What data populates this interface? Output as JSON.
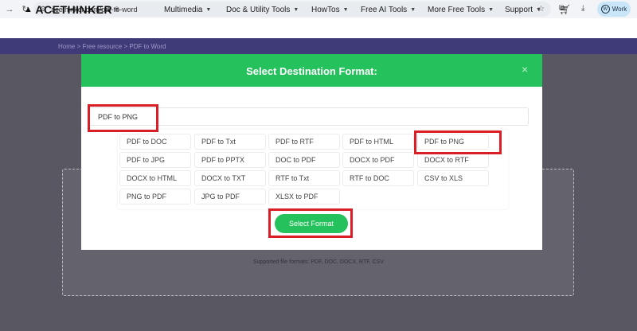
{
  "browser": {
    "url": "acethinker.com/pdf-to-word",
    "profile_label": "Work"
  },
  "header": {
    "logo_text": "ACETHINKER",
    "logo_mark": "®",
    "nav": [
      {
        "label": "Multimedia"
      },
      {
        "label": "Doc & Utility Tools"
      },
      {
        "label": "HowTos"
      },
      {
        "label": "Free AI Tools"
      },
      {
        "label": "More Free Tools"
      },
      {
        "label": "Support"
      }
    ]
  },
  "breadcrumb": "Home > Free resource > PDF to Word",
  "modal": {
    "title": "Select Destination Format:",
    "close": "×",
    "search_value": "PDF to PNG",
    "formats": [
      [
        "PDF to DOC",
        "PDF to Txt",
        "PDF to RTF",
        "PDF to HTML",
        "PDF to PNG"
      ],
      [
        "PDF to JPG",
        "PDF to PPTX",
        "DOC to PDF",
        "DOCX to PDF",
        "DOCX to RTF"
      ],
      [
        "DOCX to HTML",
        "DOCX to TXT",
        "RTF to Txt",
        "RTF to DOC",
        "CSV to XLS"
      ],
      [
        "PNG to PDF",
        "JPG to PDF",
        "XLSX to PDF"
      ]
    ],
    "select_button": "Select Format"
  },
  "page": {
    "supported_formats": "Supported file formats: PDF, DOC, DOCX, RTF, CSV"
  },
  "colors": {
    "accent_green": "#25c15c",
    "highlight_red": "#d91e26",
    "band_purple": "#3f3a78"
  }
}
